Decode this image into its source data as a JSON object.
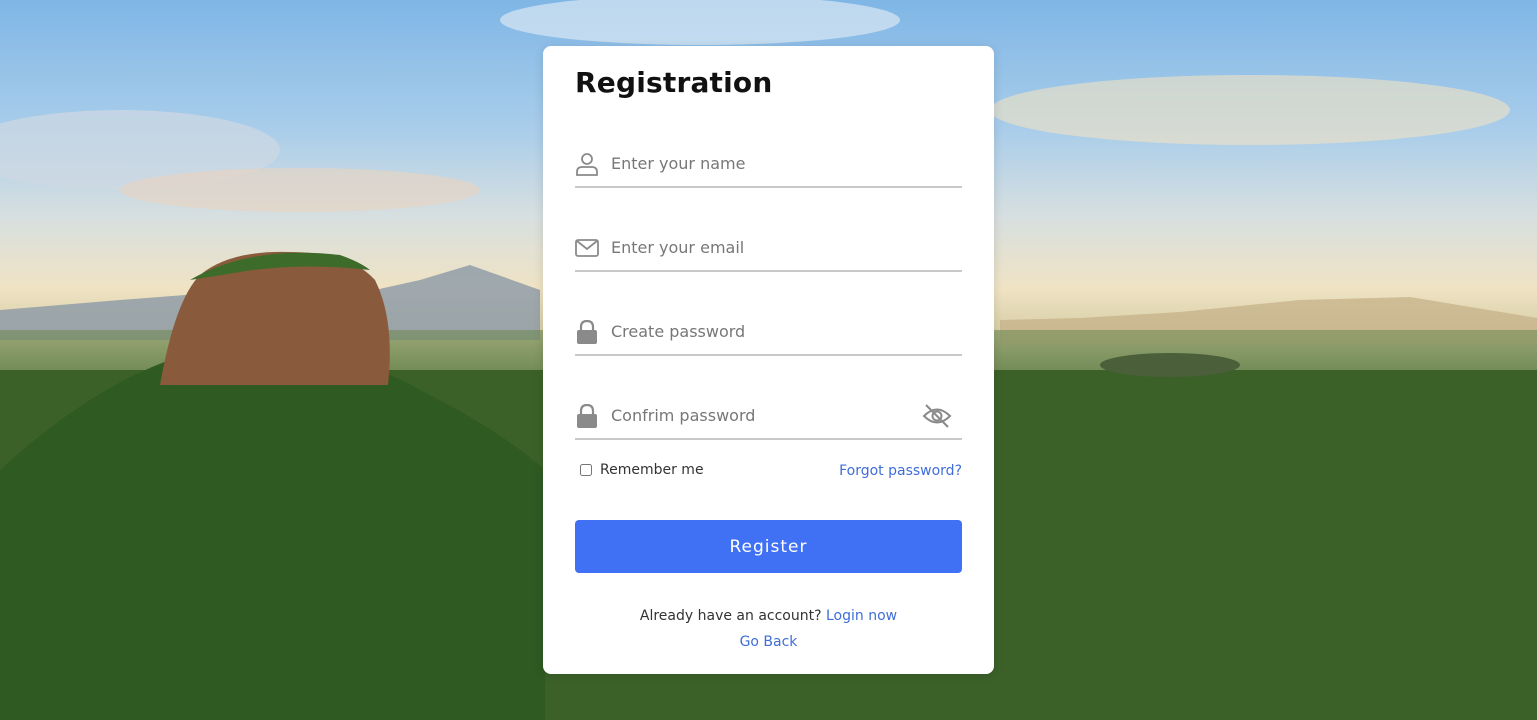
{
  "form": {
    "title": "Registration",
    "fields": [
      {
        "icon": "user-icon",
        "placeholder": "Enter your name",
        "value": ""
      },
      {
        "icon": "envelope-icon",
        "placeholder": "Enter your email",
        "value": ""
      },
      {
        "icon": "lock-icon",
        "placeholder": "Create password",
        "value": ""
      },
      {
        "icon": "lock-icon",
        "placeholder": "Confrim password",
        "value": ""
      }
    ],
    "toggle_password_icon": "eye-slash-icon",
    "remember_label": "Remember me",
    "remember_checked": false,
    "forgot_label": "Forgot password?",
    "register_label": "Register",
    "already_text": "Already have an account?",
    "login_label": "Login now",
    "goback_label": "Go Back"
  },
  "colors": {
    "accent": "#4070f4",
    "link": "#3f6ed8",
    "icon": "#8a8a8a",
    "card": "#ffffff"
  }
}
